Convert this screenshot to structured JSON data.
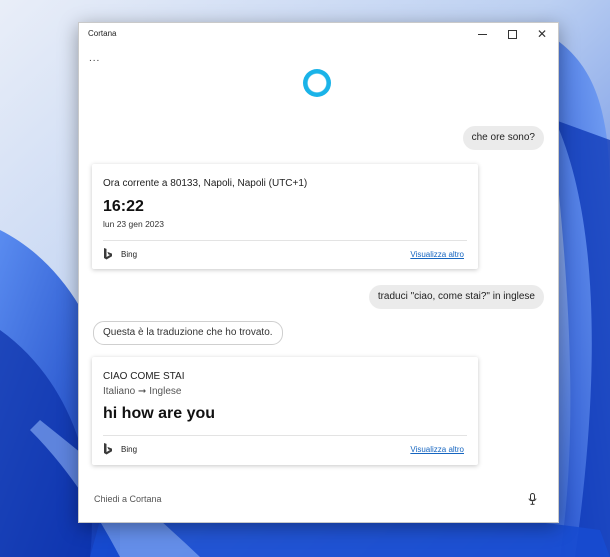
{
  "window": {
    "title": "Cortana",
    "controls": {
      "minimize": "minimize-icon",
      "maximize": "maximize-icon",
      "close": "close-icon"
    }
  },
  "more_options": "...",
  "conversation": {
    "user_message_1": "che ore sono?",
    "time_card": {
      "location": "Ora corrente a 80133, Napoli, Napoli (UTC+1)",
      "time": "16:22",
      "date": "lun 23 gen 2023",
      "source": "Bing",
      "more_link": "Visualizza altro"
    },
    "user_message_2": "traduci \"ciao, come stai?\" in inglese",
    "cortana_reply": "Questa è la traduzione che ho trovato.",
    "translation_card": {
      "phrase": "CIAO COME STAI",
      "from_lang": "Italiano",
      "arrow": "➞",
      "to_lang": "Inglese",
      "translation": "hi how are you",
      "source": "Bing",
      "more_link": "Visualizza altro"
    }
  },
  "input": {
    "placeholder": "Chiedi a Cortana"
  },
  "colors": {
    "accent": "#1ab3e8",
    "link": "#1565c0",
    "user_bubble": "#ebebeb",
    "wallpaper": "#2f5fd6"
  },
  "icons": [
    "cortana-ring-icon",
    "bing-icon",
    "microphone-icon",
    "minimize-icon",
    "maximize-icon",
    "close-icon"
  ]
}
